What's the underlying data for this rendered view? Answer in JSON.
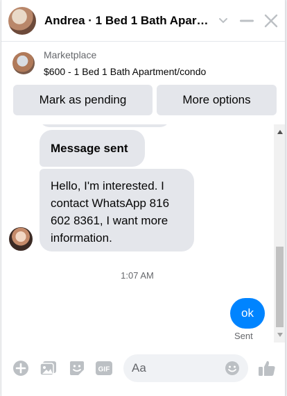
{
  "header": {
    "title": "Andrea · 1 Bed 1 Bath Apar…",
    "icons": [
      "chevron-down-icon",
      "minimize-icon",
      "close-icon"
    ]
  },
  "listing": {
    "source": "Marketplace",
    "description": "$600 - 1 Bed 1 Bath Apartment/condo",
    "mark_pending_label": "Mark as pending",
    "more_options_label": "More options"
  },
  "messages": [
    {
      "from": "contact",
      "text": "Message sent"
    },
    {
      "from": "contact",
      "text": "Hello, I'm interested. I contact WhatsApp 816 602 8361, I want more information."
    }
  ],
  "timestamp": "1:07 AM",
  "outgoing": {
    "text": "ok",
    "status": "Sent"
  },
  "composer": {
    "placeholder": "Aa",
    "icons": [
      "add-icon",
      "photo-icon",
      "sticker-icon",
      "gif-icon",
      "emoji-icon",
      "like-icon"
    ],
    "gif_label": "GIF"
  },
  "colors": {
    "accent": "#0084ff",
    "bubble_in": "#e4e6eb",
    "icon_gray": "#bcc0c4",
    "secondary_text": "#65676b"
  }
}
